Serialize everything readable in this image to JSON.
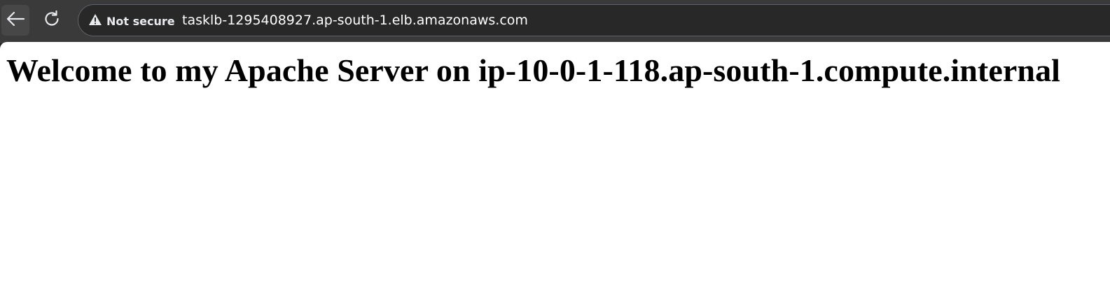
{
  "browser": {
    "toolbar": {
      "back_icon": "arrow-left-icon",
      "reload_icon": "reload-icon"
    },
    "omnibox": {
      "security_icon": "warning-triangle-icon",
      "security_label": "Not secure",
      "url": "tasklb-1295408927.ap-south-1.elb.amazonaws.com"
    },
    "colors": {
      "toolbar_bg": "#3a3a3a",
      "omnibox_bg": "#282828",
      "text_light": "#e8eaed",
      "page_bg": "#ffffff",
      "page_text": "#000000"
    }
  },
  "page": {
    "heading": "Welcome to my Apache Server on ip-10-0-1-118.ap-south-1.compute.internal"
  }
}
